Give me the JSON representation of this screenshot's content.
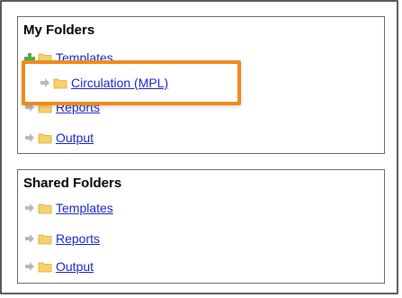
{
  "my_folders": {
    "title": "My Folders",
    "items": [
      {
        "label": "Templates",
        "expanded": true
      },
      {
        "label": "Reports",
        "expanded": false
      },
      {
        "label": "Output",
        "expanded": false
      }
    ],
    "subitems": [
      {
        "label": "Circulation (MPL)"
      }
    ]
  },
  "shared_folders": {
    "title": "Shared Folders",
    "items": [
      {
        "label": "Templates"
      },
      {
        "label": "Reports"
      },
      {
        "label": "Output"
      }
    ]
  },
  "colors": {
    "highlight": "#f08a1c",
    "link": "#1a24c8",
    "folder": "#f6d36a",
    "arrow": "#b9b9b9",
    "plus": "#4caf50"
  },
  "icons": {
    "expand": "plus-icon",
    "collapsed": "arrow-right-icon",
    "folder": "folder-icon"
  }
}
